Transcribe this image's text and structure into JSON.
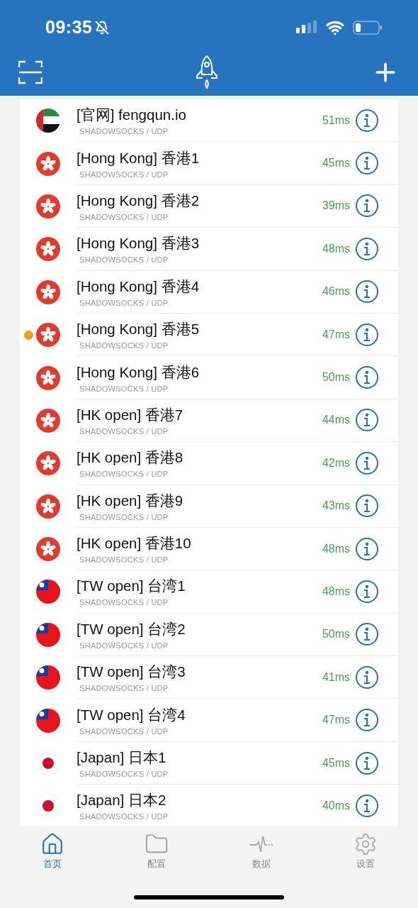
{
  "status_bar": {
    "time": "09:35"
  },
  "servers": [
    {
      "kind": "uae",
      "name": "[官网] fengqun.io",
      "protocol": "SHADOWSOCKS / UDP",
      "latency": "51ms",
      "selected": false
    },
    {
      "kind": "hk",
      "name": "[Hong Kong] 香港1",
      "protocol": "SHADOWSOCKS / UDP",
      "latency": "45ms",
      "selected": false
    },
    {
      "kind": "hk",
      "name": "[Hong Kong] 香港2",
      "protocol": "SHADOWSOCKS / UDP",
      "latency": "39ms",
      "selected": false
    },
    {
      "kind": "hk",
      "name": "[Hong Kong] 香港3",
      "protocol": "SHADOWSOCKS / UDP",
      "latency": "48ms",
      "selected": false
    },
    {
      "kind": "hk",
      "name": "[Hong Kong] 香港4",
      "protocol": "SHADOWSOCKS / UDP",
      "latency": "46ms",
      "selected": false
    },
    {
      "kind": "hk",
      "name": "[Hong Kong] 香港5",
      "protocol": "SHADOWSOCKS / UDP",
      "latency": "47ms",
      "selected": true
    },
    {
      "kind": "hk",
      "name": "[Hong Kong] 香港6",
      "protocol": "SHADOWSOCKS / UDP",
      "latency": "50ms",
      "selected": false
    },
    {
      "kind": "hk",
      "name": "[HK open] 香港7",
      "protocol": "SHADOWSOCKS / UDP",
      "latency": "44ms",
      "selected": false
    },
    {
      "kind": "hk",
      "name": "[HK open] 香港8",
      "protocol": "SHADOWSOCKS / UDP",
      "latency": "42ms",
      "selected": false
    },
    {
      "kind": "hk",
      "name": "[HK open] 香港9",
      "protocol": "SHADOWSOCKS / UDP",
      "latency": "43ms",
      "selected": false
    },
    {
      "kind": "hk",
      "name": "[HK open] 香港10",
      "protocol": "SHADOWSOCKS / UDP",
      "latency": "48ms",
      "selected": false
    },
    {
      "kind": "tw",
      "name": "[TW open] 台湾1",
      "protocol": "SHADOWSOCKS / UDP",
      "latency": "48ms",
      "selected": false
    },
    {
      "kind": "tw",
      "name": "[TW open] 台湾2",
      "protocol": "SHADOWSOCKS / UDP",
      "latency": "50ms",
      "selected": false
    },
    {
      "kind": "tw",
      "name": "[TW open] 台湾3",
      "protocol": "SHADOWSOCKS / UDP",
      "latency": "41ms",
      "selected": false
    },
    {
      "kind": "tw",
      "name": "[TW open] 台湾4",
      "protocol": "SHADOWSOCKS / UDP",
      "latency": "47ms",
      "selected": false
    },
    {
      "kind": "jp",
      "name": "[Japan] 日本1",
      "protocol": "SHADOWSOCKS / UDP",
      "latency": "45ms",
      "selected": false
    },
    {
      "kind": "jp",
      "name": "[Japan] 日本2",
      "protocol": "SHADOWSOCKS / UDP",
      "latency": "40ms",
      "selected": false
    }
  ],
  "tab_bar": [
    {
      "kind": "home",
      "label": "首页",
      "selected": true
    },
    {
      "kind": "folder",
      "label": "配置",
      "selected": false
    },
    {
      "kind": "pulse",
      "label": "数据",
      "selected": false
    },
    {
      "kind": "gear",
      "label": "设置",
      "selected": false
    }
  ]
}
